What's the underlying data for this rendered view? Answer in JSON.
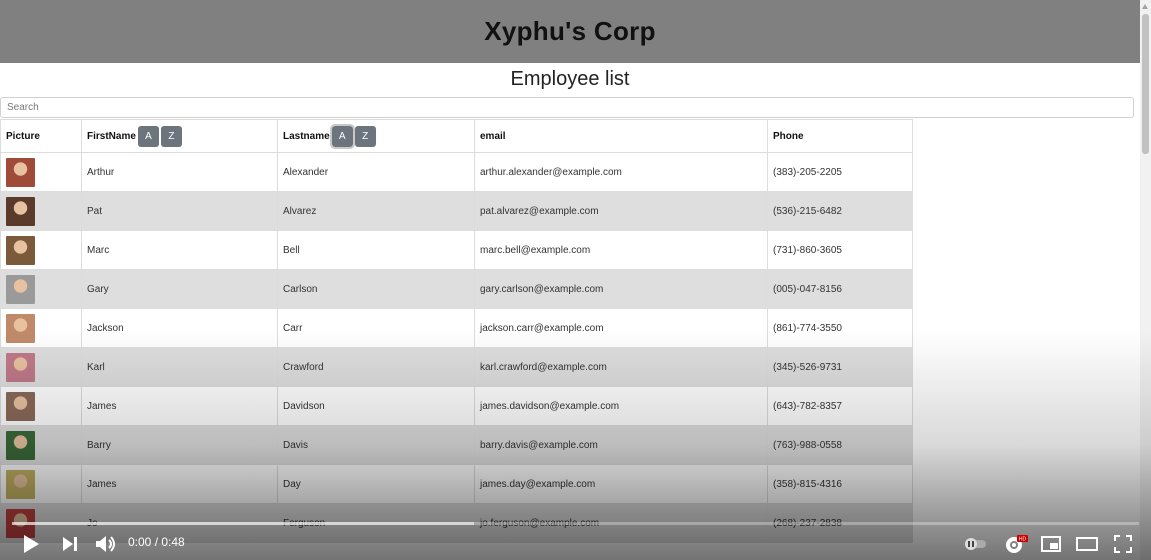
{
  "header": {
    "title": "Xyphu's Corp"
  },
  "subtitle": "Employee list",
  "search": {
    "placeholder": "Search",
    "value": ""
  },
  "table": {
    "columns": {
      "picture": "Picture",
      "firstname": "FirstName",
      "lastname": "Lastname",
      "email": "email",
      "phone": "Phone"
    },
    "sort_buttons": {
      "asc": "A",
      "desc": "Z"
    },
    "rows": [
      {
        "first": "Arthur",
        "last": "Alexander",
        "email": "arthur.alexander@example.com",
        "phone": "(383)-205-2205",
        "avatar_color": "#a04a3a"
      },
      {
        "first": "Pat",
        "last": "Alvarez",
        "email": "pat.alvarez@example.com",
        "phone": "(536)-215-6482",
        "avatar_color": "#5a3a2a"
      },
      {
        "first": "Marc",
        "last": "Bell",
        "email": "marc.bell@example.com",
        "phone": "(731)-860-3605",
        "avatar_color": "#7a5a3a"
      },
      {
        "first": "Gary",
        "last": "Carlson",
        "email": "gary.carlson@example.com",
        "phone": "(005)-047-8156",
        "avatar_color": "#9a9a9a"
      },
      {
        "first": "Jackson",
        "last": "Carr",
        "email": "jackson.carr@example.com",
        "phone": "(861)-774-3550",
        "avatar_color": "#c08a6a"
      },
      {
        "first": "Karl",
        "last": "Crawford",
        "email": "karl.crawford@example.com",
        "phone": "(345)-526-9731",
        "avatar_color": "#c07a8a"
      },
      {
        "first": "James",
        "last": "Davidson",
        "email": "james.davidson@example.com",
        "phone": "(643)-782-8357",
        "avatar_color": "#8a6a5a"
      },
      {
        "first": "Barry",
        "last": "Davis",
        "email": "barry.davis@example.com",
        "phone": "(763)-988-0558",
        "avatar_color": "#3a6a3a"
      },
      {
        "first": "James",
        "last": "Day",
        "email": "james.day@example.com",
        "phone": "(358)-815-4316",
        "avatar_color": "#c0b060"
      },
      {
        "first": "Jo",
        "last": "Ferguson",
        "email": "jo.ferguson@example.com",
        "phone": "(268)-237-2838",
        "avatar_color": "#c04040"
      }
    ]
  },
  "video": {
    "time": "0:00 / 0:48",
    "progress_loaded": 0.41,
    "hd_badge": "HD"
  },
  "colors": {
    "header_bg": "#808080",
    "sort_button": "#6c757d",
    "shaded_row": "#dedede"
  }
}
